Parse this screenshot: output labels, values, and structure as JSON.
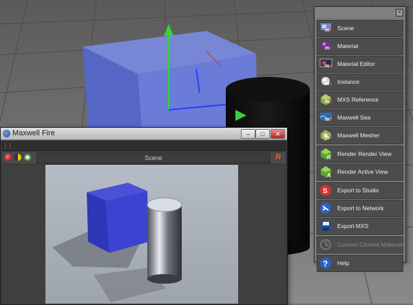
{
  "fire_window": {
    "title": "Maxwell Fire",
    "buttons": {
      "minimize": "–",
      "maximize": "□",
      "close": "✕"
    },
    "scene_label": "Scene",
    "render_button": "R"
  },
  "palette": {
    "close": "×",
    "items": [
      {
        "label": "Scene",
        "icon": "scene-icon"
      },
      {
        "label": "Material",
        "icon": "material-sphere-icon"
      },
      {
        "label": "Material Editor",
        "icon": "material-editor-icon"
      },
      {
        "label": "Instance",
        "icon": "instance-icon"
      },
      {
        "label": "MXS Reference",
        "icon": "mxs-reference-icon"
      },
      {
        "label": "Maxwell Sea",
        "icon": "maxwell-sea-icon"
      },
      {
        "label": "Maxwell Mesher",
        "icon": "maxwell-mesher-icon"
      },
      {
        "label": "Render Render View",
        "icon": "render-render-view-icon"
      },
      {
        "label": "Render Active View",
        "icon": "render-active-view-icon"
      },
      {
        "label": "Export to Studio",
        "icon": "export-studio-icon"
      },
      {
        "label": "Export to Network",
        "icon": "export-network-icon"
      },
      {
        "label": "Export MXS",
        "icon": "export-mxs-icon"
      },
      {
        "label": "Convert Cinema Materials",
        "icon": "convert-materials-icon"
      },
      {
        "label": "Help",
        "icon": "help-icon"
      }
    ]
  }
}
